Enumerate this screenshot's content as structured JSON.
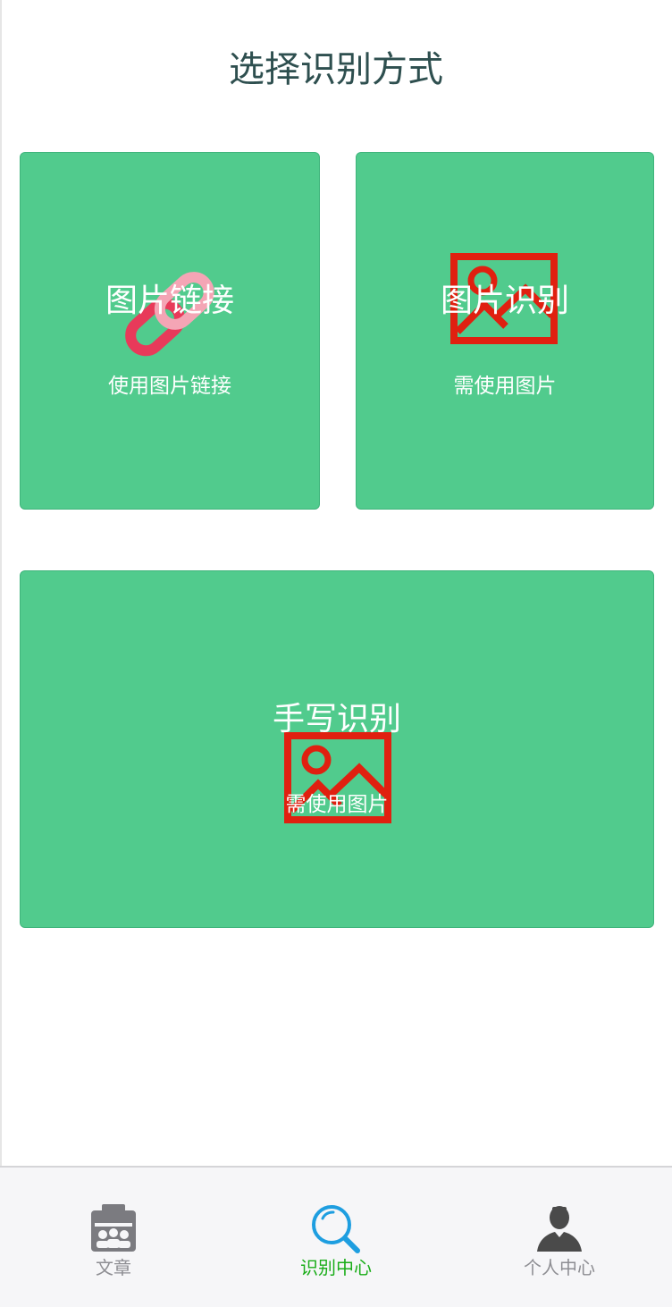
{
  "page": {
    "title": "选择识别方式"
  },
  "cards": {
    "link": {
      "title": "图片链接",
      "subtitle": "使用图片链接",
      "icon": "link-icon"
    },
    "image": {
      "title": "图片识别",
      "subtitle": "需使用图片",
      "icon": "image-icon"
    },
    "handwriting": {
      "title": "手写识别",
      "subtitle": "需使用图片",
      "icon": "image-icon"
    }
  },
  "tabbar": {
    "selected": "tab-recognition",
    "tabs": [
      {
        "label": "文章",
        "icon": "articles-icon"
      },
      {
        "label": "识别中心",
        "icon": "search-icon"
      },
      {
        "label": "个人中心",
        "icon": "user-icon"
      }
    ]
  },
  "colors": {
    "card_background": "#51cb8d",
    "title_text": "#2e4f4f",
    "tab_active": "#1aad19",
    "tab_inactive": "#8e8e93",
    "search_icon": "#1e9ee0",
    "image_icon": "#e02010",
    "link_icon": "#e83a5a"
  }
}
